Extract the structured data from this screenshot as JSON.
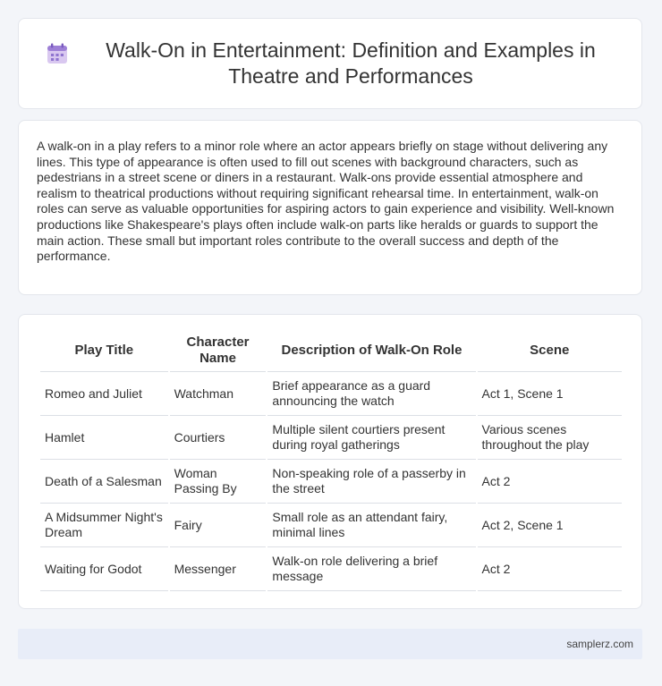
{
  "header": {
    "title": "Walk-On in Entertainment: Definition and Examples in Theatre and Performances",
    "icon": "calendar-icon"
  },
  "intro": {
    "text": "A walk-on in a play refers to a minor role where an actor appears briefly on stage without delivering any lines. This type of appearance is often used to fill out scenes with background characters, such as pedestrians in a street scene or diners in a restaurant. Walk-ons provide essential atmosphere and realism to theatrical productions without requiring significant rehearsal time. In entertainment, walk-on roles can serve as valuable opportunities for aspiring actors to gain experience and visibility. Well-known productions like Shakespeare's plays often include walk-on parts like heralds or guards to support the main action. These small but important roles contribute to the overall success and depth of the performance."
  },
  "table": {
    "headers": [
      "Play Title",
      "Character Name",
      "Description of Walk-On Role",
      "Scene"
    ],
    "rows": [
      [
        "Romeo and Juliet",
        "Watchman",
        "Brief appearance as a guard announcing the watch",
        "Act 1, Scene 1"
      ],
      [
        "Hamlet",
        "Courtiers",
        "Multiple silent courtiers present during royal gatherings",
        "Various scenes throughout the play"
      ],
      [
        "Death of a Salesman",
        "Woman Passing By",
        "Non-speaking role of a passerby in the street",
        "Act 2"
      ],
      [
        "A Midsummer Night's Dream",
        "Fairy",
        "Small role as an attendant fairy, minimal lines",
        "Act 2, Scene 1"
      ],
      [
        "Waiting for Godot",
        "Messenger",
        "Walk-on role delivering a brief message",
        "Act 2"
      ]
    ]
  },
  "footer": {
    "site": "samplerz.com"
  }
}
